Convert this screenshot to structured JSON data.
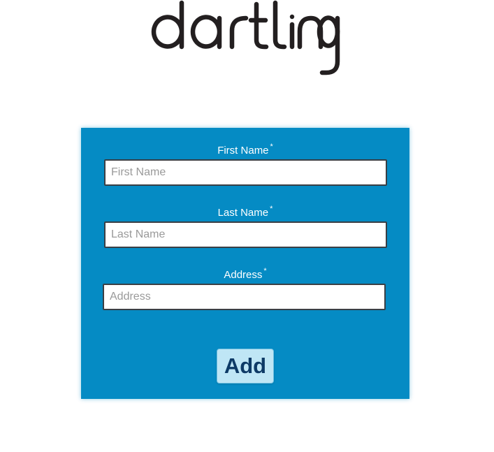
{
  "logo": {
    "text": "dartling"
  },
  "form": {
    "first_name": {
      "label": "First Name",
      "required_mark": "*",
      "placeholder": "First Name",
      "value": ""
    },
    "last_name": {
      "label": "Last Name",
      "required_mark": "*",
      "placeholder": "Last Name",
      "value": ""
    },
    "address": {
      "label": "Address",
      "required_mark": "*",
      "placeholder": "Address",
      "value": ""
    },
    "submit_label": "Add"
  },
  "colors": {
    "panel_background": "#058bc4",
    "button_background": "#bfe6f5",
    "button_text": "#0d3a66",
    "label_text": "#ffffff",
    "logo_color": "#231f20"
  }
}
